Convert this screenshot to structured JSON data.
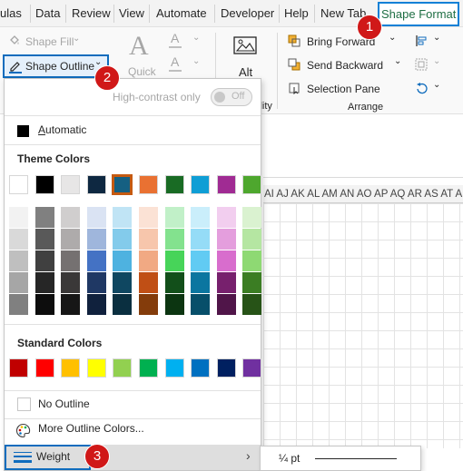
{
  "tabs": [
    {
      "label": "ulas"
    },
    {
      "label": "Data"
    },
    {
      "label": "Review"
    },
    {
      "label": "View"
    },
    {
      "label": "Automate"
    },
    {
      "label": "Developer"
    },
    {
      "label": "Help"
    },
    {
      "label": "New Tab"
    },
    {
      "label": "Shape Format",
      "active": true
    }
  ],
  "ribbon": {
    "shape_fill": "Shape Fill",
    "shape_outline": "Shape Outline",
    "quick": "Quick",
    "alt": "Alt",
    "ility": "ility",
    "bring_forward": "Bring Forward",
    "send_backward": "Send Backward",
    "selection_pane": "Selection Pane",
    "arrange_group": "Arrange"
  },
  "grid": {
    "column_headers": "AI AJ AK AL AM AN AO AP AQ AR AS AT AU"
  },
  "dropdown": {
    "high_contrast": "High-contrast only",
    "toggle_state": "Off",
    "automatic": "Automatic",
    "theme_colors_heading": "Theme Colors",
    "standard_colors_heading": "Standard Colors",
    "no_outline": "No Outline",
    "more_outline_colors": "More Outline Colors...",
    "weight": "Weight"
  },
  "theme_colors": [
    "#ffffff",
    "#000000",
    "#e7e6e6",
    "#0e2841",
    "#156082",
    "#e97132",
    "#196b24",
    "#0f9ed5",
    "#a02b93",
    "#4ea72e"
  ],
  "theme_shades": [
    [
      "#f2f2f2",
      "#d9d9d9",
      "#bfbfbf",
      "#a6a6a6",
      "#808080"
    ],
    [
      "#808080",
      "#595959",
      "#404040",
      "#262626",
      "#0d0d0d"
    ],
    [
      "#d0cece",
      "#aeabab",
      "#757171",
      "#3a3838",
      "#161616"
    ],
    [
      "#dae3f3",
      "#9fb6dc",
      "#4472c4",
      "#1f3864",
      "#10213d"
    ],
    [
      "#c0e4f5",
      "#83cbeb",
      "#4eb2e0",
      "#0f4761",
      "#0a2f40"
    ],
    [
      "#fbe2d5",
      "#f7c6ac",
      "#f1a983",
      "#c04f15",
      "#843c0b"
    ],
    [
      "#c1f0c8",
      "#83e28e",
      "#47d459",
      "#124f1a",
      "#0c3511"
    ],
    [
      "#caeefb",
      "#95dcf7",
      "#61cbf3",
      "#0b76a0",
      "#074f6a"
    ],
    [
      "#f2ceef",
      "#e49edd",
      "#d86dcd",
      "#77206d",
      "#501549"
    ],
    [
      "#daf2d0",
      "#b5e6a2",
      "#8ed973",
      "#3b7d23",
      "#275317"
    ]
  ],
  "standard_colors": [
    "#c00000",
    "#ff0000",
    "#ffc000",
    "#ffff00",
    "#92d050",
    "#00b050",
    "#00b0f0",
    "#0070c0",
    "#002060",
    "#7030a0"
  ],
  "submenu": {
    "first_weight": "¼ pt"
  },
  "badges": {
    "one": "1",
    "two": "2",
    "three": "3"
  }
}
